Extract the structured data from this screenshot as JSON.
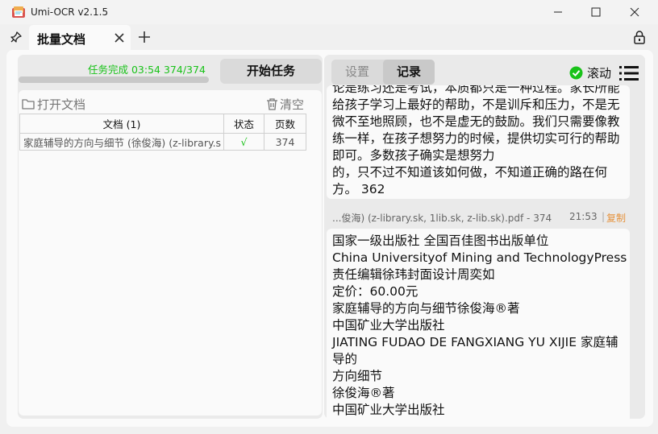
{
  "window": {
    "title": "Umi-OCR v2.1.5",
    "icon": "app-icon"
  },
  "tabs": [
    {
      "label": "批量文档",
      "active": true
    }
  ],
  "left": {
    "status": "任务完成  03:54  374/374",
    "progress": 1.0,
    "start_button": "开始任务",
    "open_button": "打开文档",
    "clear_button": "清空",
    "table": {
      "headers": [
        "文档 (1)",
        "状态",
        "页数"
      ],
      "rows": [
        {
          "name": "家庭辅导的方向与细节 (徐俊海) (z-library.s",
          "status": "√",
          "pages": "374"
        }
      ]
    }
  },
  "right": {
    "tabs": [
      "设置",
      "记录"
    ],
    "active_tab": "记录",
    "scroll_label": "滚动",
    "record_top": "论是练习还是考试，本质都只是一种过程。家长所能给孩子学习上最好的帮助，不是训斥和压力，不是无微不至地照顾，也不是虚无的鼓励。我们只需要像教练一样，在孩子想努力的时候，提供切实可行的帮助即可。多数孩子确实是想努力\n的，只不过不知道该如何做，不知道正确的路在何方。 362",
    "record_file": "...俊海) (z-library.sk, 1lib.sk, z-lib.sk).pdf - 374",
    "record_time": "21:53",
    "record_sep": "|",
    "record_copy": "复制",
    "record_bottom": "国家一级出版社 全国百佳图书出版单位\nChina Universityof Mining and TechnologyPress\n责任编辑徐玮封面设计周奕如\n定价：60.00元\n家庭辅导的方向与细节徐俊海®著\n中国矿业大学出版社\nJIATING FUDAO DE FANGXIANG YU XIJIE 家庭辅导的\n方向细节\n徐俊海®著\n中国矿业大学出版社"
  },
  "colors": {
    "success": "#19c219",
    "copy": "#e6923c"
  }
}
